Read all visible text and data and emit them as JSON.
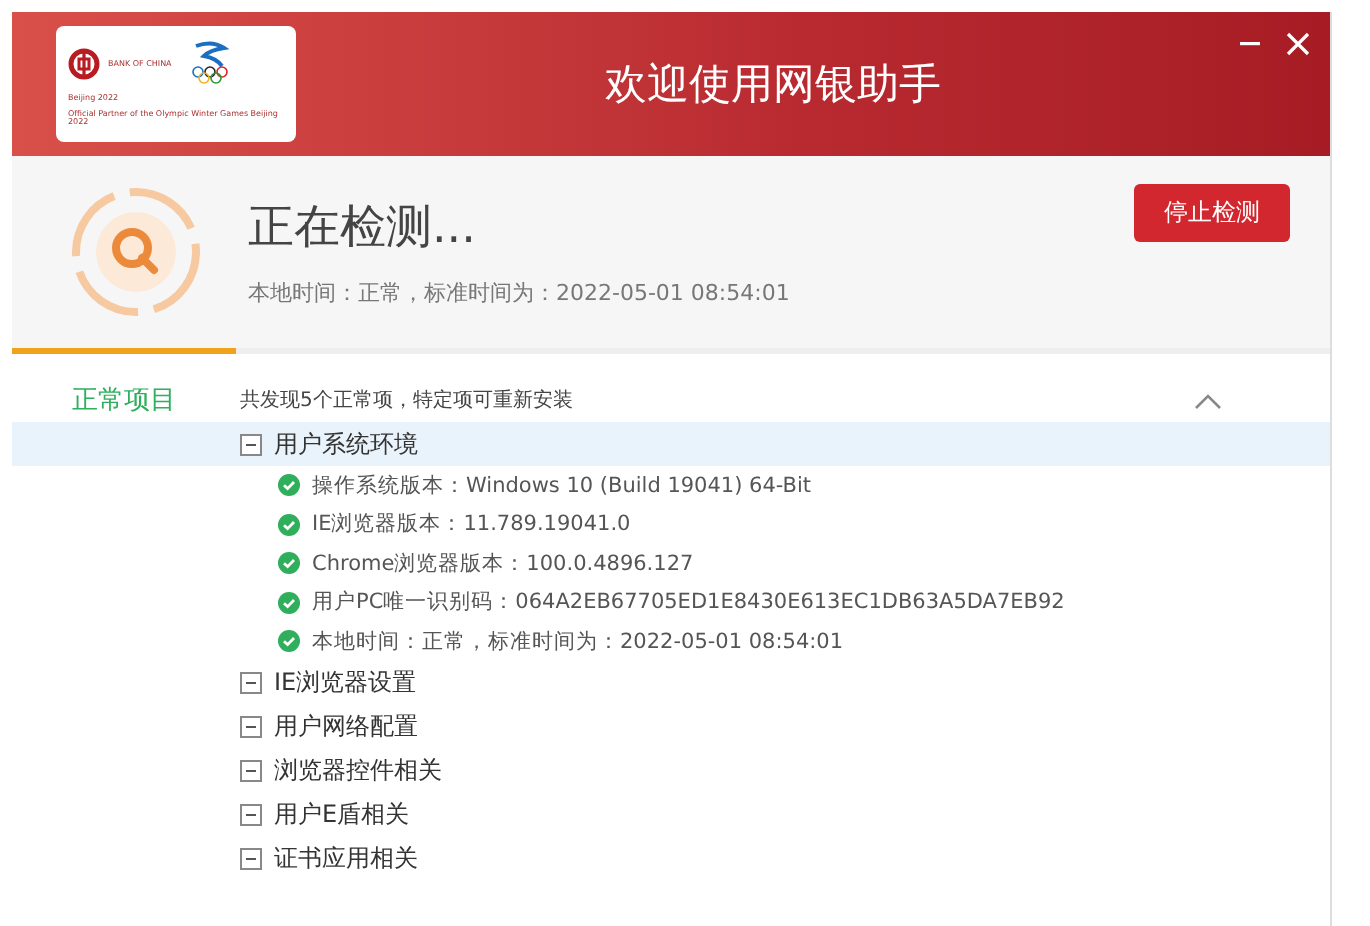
{
  "window": {
    "title": "欢迎使用网银助手"
  },
  "logo": {
    "bank_name": "BANK OF CHINA",
    "partner_line": "Official Partner of the Olympic Winter Games Beijing 2022",
    "games_mark": "Beijing 2022"
  },
  "status": {
    "heading": "正在检测...",
    "detail": "本地时间：正常，标准时间为：2022-05-01 08:54:01",
    "stop_button": "停止检测",
    "progress": {
      "level": 0.17
    }
  },
  "category": {
    "label": "正常项目",
    "summary": "共发现5个正常项，特定项可重新安装",
    "expanded": true
  },
  "groups": [
    {
      "label": "用户系统环境",
      "selected": true,
      "children": [
        {
          "text": "操作系统版本：Windows 10  (Build 19041) 64-Bit"
        },
        {
          "text": "IE浏览器版本：11.789.19041.0"
        },
        {
          "text": "Chrome浏览器版本：100.0.4896.127"
        },
        {
          "text": "用户PC唯一识别码：064A2EB67705ED1E8430E613EC1DB63A5DA7EB92"
        },
        {
          "text": "本地时间：正常，标准时间为：2022-05-01 08:54:01"
        }
      ]
    },
    {
      "label": "IE浏览器设置",
      "selected": false
    },
    {
      "label": "用户网络配置",
      "selected": false
    },
    {
      "label": "浏览器控件相关",
      "selected": false
    },
    {
      "label": "用户E盾相关",
      "selected": false
    },
    {
      "label": "证书应用相关",
      "selected": false
    }
  ]
}
